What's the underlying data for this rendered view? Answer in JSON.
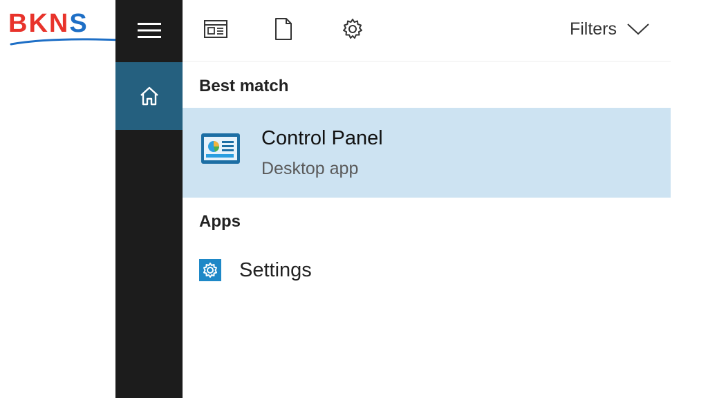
{
  "logo": {
    "text_main": "BKN",
    "text_accent": "S"
  },
  "rail": {
    "menu_icon": "hamburger-icon",
    "home_icon": "home-icon"
  },
  "toolbar": {
    "icons": [
      "news-icon",
      "document-icon",
      "gear-icon"
    ],
    "filters_label": "Filters"
  },
  "results": {
    "best_match_heading": "Best match",
    "best_match": {
      "title": "Control Panel",
      "subtitle": "Desktop app",
      "icon": "control-panel-icon"
    },
    "apps_heading": "Apps",
    "apps": [
      {
        "label": "Settings",
        "icon": "settings-icon"
      }
    ]
  },
  "colors": {
    "rail": "#1c1c1c",
    "home_selected": "#25607f",
    "highlight": "#cde3f2",
    "logo_red": "#e8332b",
    "logo_blue": "#1e6fc6"
  }
}
